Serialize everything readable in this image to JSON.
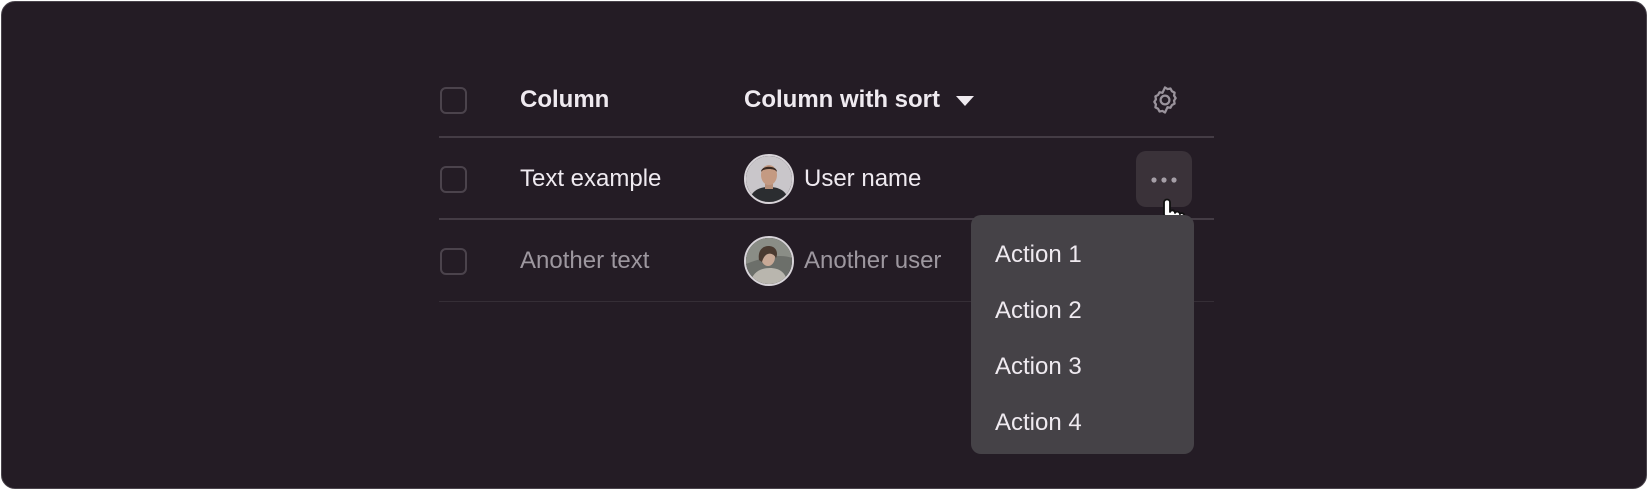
{
  "table": {
    "header": {
      "col1": "Column",
      "col2": "Column with sort"
    },
    "rows": [
      {
        "text": "Text example",
        "user": "User name"
      },
      {
        "text": "Another text",
        "user": "Another user"
      }
    ]
  },
  "menu": {
    "items": [
      "Action 1",
      "Action 2",
      "Action 3",
      "Action 4"
    ]
  },
  "icons": {
    "settings": "gear-icon",
    "more": "more-horizontal-icon",
    "sort": "caret-down-icon",
    "cursor": "hand-pointer-icon"
  },
  "colors": {
    "background": "#241c25",
    "menu_background": "#454247",
    "text_primary": "#efeaf0",
    "text_muted": "#9d979f",
    "divider": "#443c45"
  }
}
